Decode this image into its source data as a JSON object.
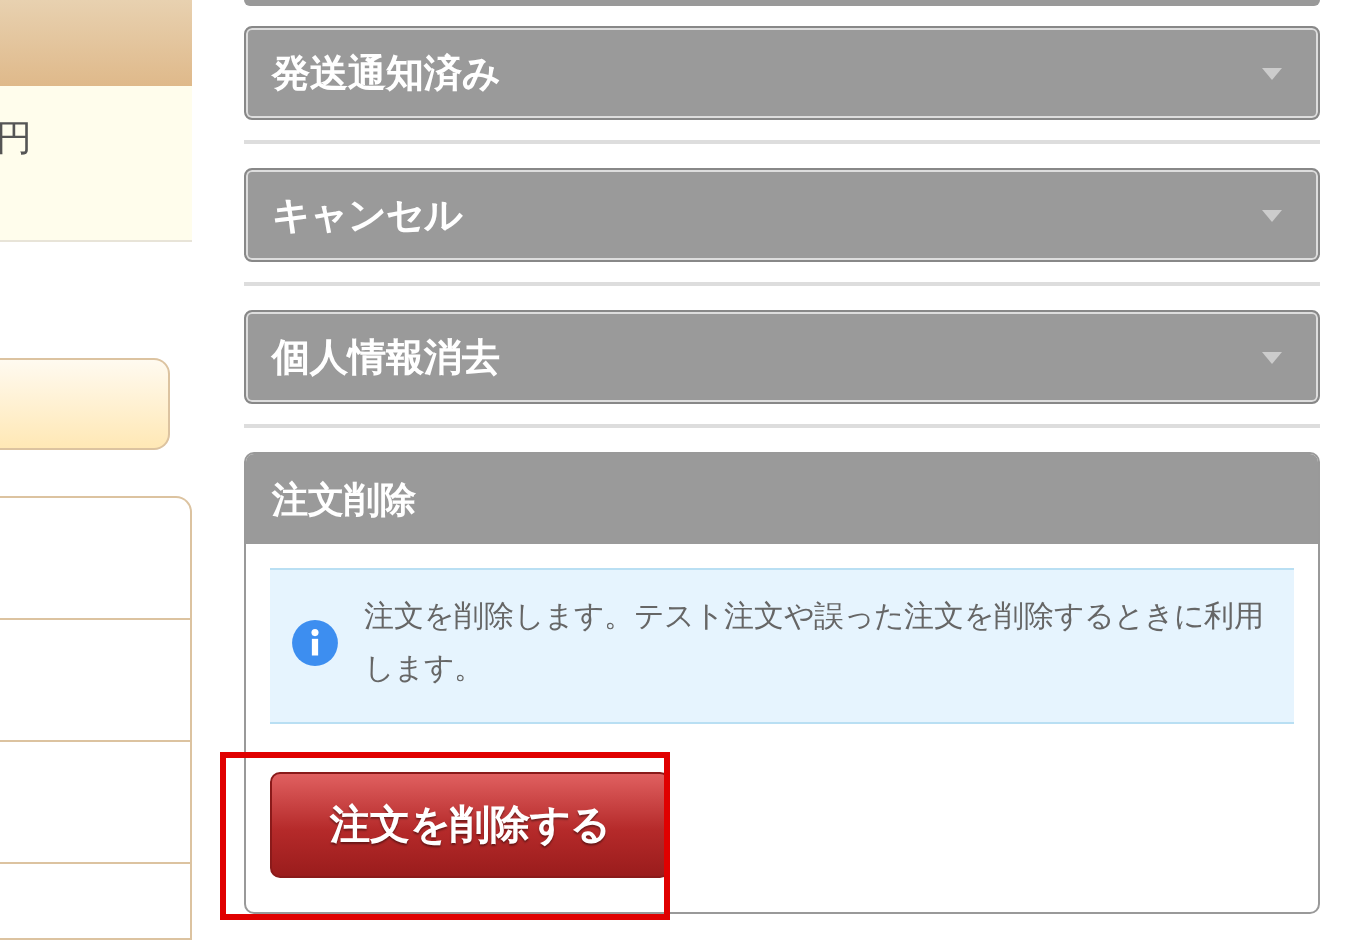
{
  "left_panel": {
    "amount_unit": "円"
  },
  "sections": [
    {
      "title": "発送通知済み",
      "expanded": false
    },
    {
      "title": "キャンセル",
      "expanded": false
    },
    {
      "title": "個人情報消去",
      "expanded": false
    },
    {
      "title": "注文削除",
      "expanded": true,
      "message": "注文を削除します。テスト注文や誤った注文を削除するときに利用します。",
      "button": {
        "label": "注文を削除する",
        "highlighted": true
      }
    }
  ]
}
